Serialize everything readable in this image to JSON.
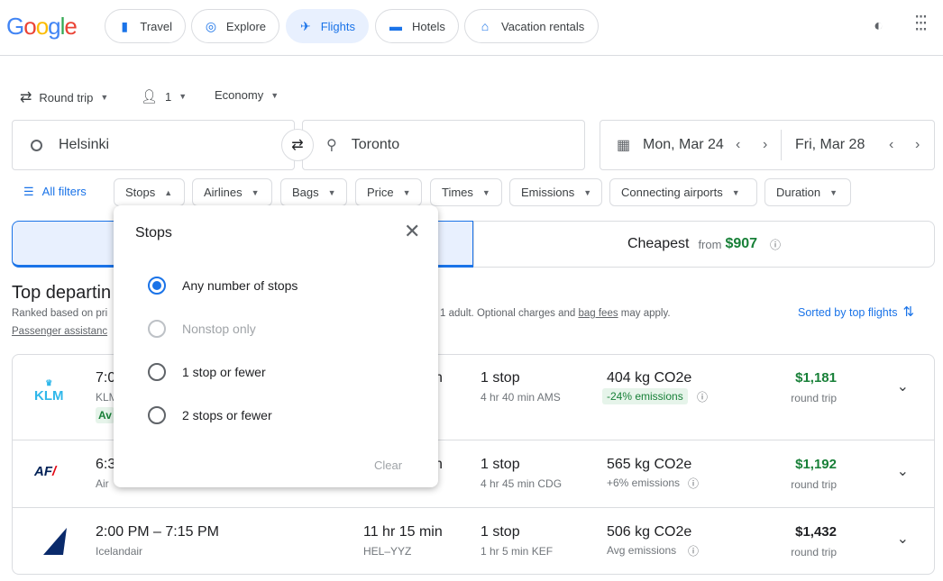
{
  "header": {
    "logo": "Google",
    "nav": [
      {
        "label": "Travel",
        "icon": "luggage-icon"
      },
      {
        "label": "Explore",
        "icon": "explore-icon"
      },
      {
        "label": "Flights",
        "icon": "plane-icon",
        "active": true
      },
      {
        "label": "Hotels",
        "icon": "bed-icon"
      },
      {
        "label": "Vacation rentals",
        "icon": "house-icon"
      }
    ]
  },
  "search": {
    "trip_type": "Round trip",
    "passengers": "1",
    "cabin": "Economy",
    "origin": "Helsinki",
    "destination": "Toronto",
    "depart": "Mon, Mar 24",
    "return": "Fri, Mar 28"
  },
  "filters": {
    "all": "All filters",
    "chips": [
      "Stops",
      "Airlines",
      "Bags",
      "Price",
      "Times",
      "Emissions",
      "Connecting airports",
      "Duration"
    ]
  },
  "tabs": {
    "cheapest": "Cheapest",
    "from": "from",
    "cheapest_price": "$907"
  },
  "results": {
    "title_fragment": "Top departin",
    "subtitle_fragment": "Ranked based on pri",
    "subtitle_tail": "r 1 adult. Optional charges and ",
    "bag_fees": "bag fees",
    "subtitle_end": " may apply.",
    "assist_fragment": "Passenger assistanc",
    "sort": "Sorted by top flights",
    "flights": [
      {
        "airline_logo": "KLM",
        "time_fragment": "7:0",
        "airline_fragment": "KLM",
        "badge_fragment": "Av",
        "duration_fragment": "n",
        "stops": "1 stop",
        "layover": "4 hr 40 min AMS",
        "co2": "404 kg CO2e",
        "emissions": "-24% emissions",
        "price": "$1,181",
        "price_note": "round trip",
        "price_color": "#188038"
      },
      {
        "airline_logo": "AF",
        "time_fragment": "6:3",
        "airline_fragment": "Air",
        "duration_fragment": "n",
        "stops": "1 stop",
        "layover": "4 hr 45 min CDG",
        "co2": "565 kg CO2e",
        "emissions": "+6% emissions",
        "price": "$1,192",
        "price_note": "round trip",
        "price_color": "#188038"
      },
      {
        "airline_logo": "Icelandair",
        "time": "2:00 PM – 7:15 PM",
        "airline": "Icelandair",
        "duration": "11 hr 15 min",
        "route": "HEL–YYZ",
        "stops": "1 stop",
        "layover": "1 hr 5 min KEF",
        "co2": "506 kg CO2e",
        "emissions": "Avg emissions",
        "price": "$1,432",
        "price_note": "round trip",
        "price_color": "#202124"
      }
    ]
  },
  "popup": {
    "title": "Stops",
    "options": [
      {
        "label": "Any number of stops",
        "selected": true
      },
      {
        "label": "Nonstop only",
        "disabled": true
      },
      {
        "label": "1 stop or fewer"
      },
      {
        "label": "2 stops or fewer"
      }
    ],
    "clear": "Clear"
  },
  "colors": {
    "accent": "#1a73e8",
    "green": "#188038"
  }
}
